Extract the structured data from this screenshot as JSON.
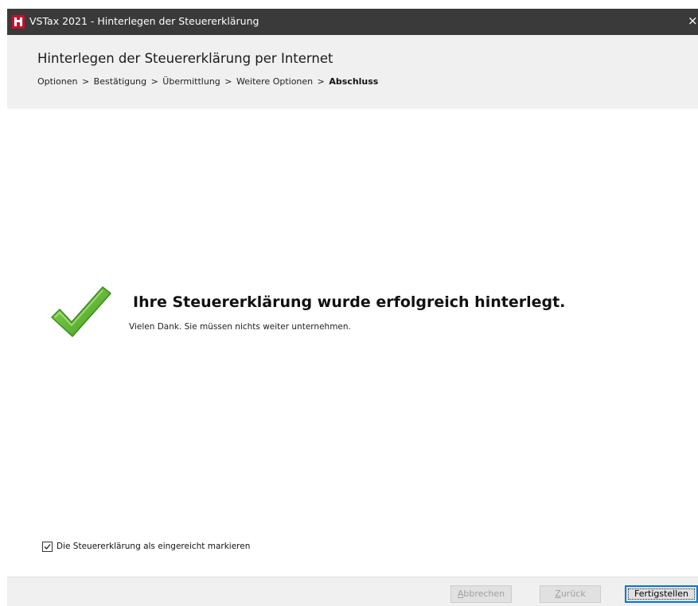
{
  "window": {
    "title": "VSTax 2021 - Hinterlegen der Steuererklärung",
    "close_glyph": "×",
    "icon": "vstax-app-icon"
  },
  "header": {
    "title": "Hinterlegen der Steuererklärung per Internet",
    "breadcrumb": {
      "steps": [
        "Optionen",
        "Bestätigung",
        "Übermittlung",
        "Weitere Optionen"
      ],
      "separator": ">",
      "current": "Abschluss"
    }
  },
  "content": {
    "status_icon": "checkmark-icon",
    "status_color": "#5cb82e",
    "success_title": "Ihre Steuererklärung wurde erfolgreich hinterlegt.",
    "success_message": "Vielen Dank. Sie müssen nichts weiter unternehmen.",
    "mark_submitted": {
      "label": "Die Steuererklärung als eingereicht markieren",
      "checked": true
    }
  },
  "footer": {
    "cancel_label_first": "A",
    "cancel_label_rest": "bbrechen",
    "back_label_first": "Z",
    "back_label_rest": "urück",
    "finish_label": "Fertigstellen",
    "accent": "#0078d7"
  }
}
